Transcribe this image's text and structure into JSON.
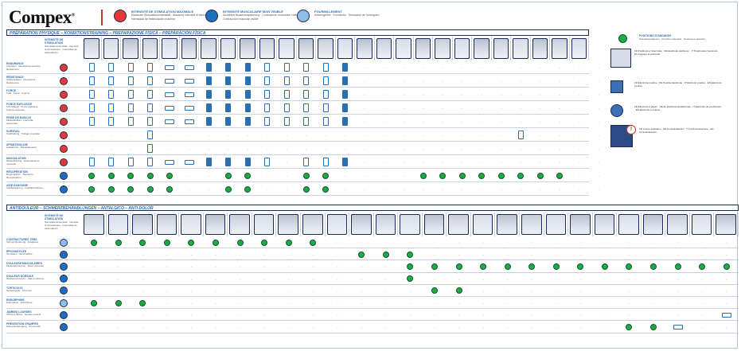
{
  "brand": {
    "name": "Compex",
    "mark": "®"
  },
  "legend": [
    {
      "color": "#e53935",
      "title": "INTENSITÉ DE STIMULATION MAXIMALE",
      "sub": "Maximale Stimulationsintensität · Massima intensità di stimolazione · Intensidad de estimulación máxima"
    },
    {
      "color": "#1e6fc0",
      "title": "INTENSITÉ MUSCULAIRE MON VISIBLE",
      "sub": "Sichtbare Muskelanspannung · Contrazione muscolare visibile · Contracción muscular visible"
    },
    {
      "color": "#8fbde6",
      "title": "FOURMILLEMENT",
      "sub": "Kribbelgefühl · Formicolio · Sensación de hormigueo"
    }
  ],
  "section1": {
    "title": "PRÉPARATION PHYSIQUE – KONDITIONSTRAINING – PREPARAZIONE FISICA – PREPARACIÓN FÍSICA",
    "colhead": {
      "title": "INTENSITÉ DE STIMULATION",
      "sub": "Stimulationsintensität · Intensità di stimolazione · Intensidad de estimulación"
    },
    "rows": [
      {
        "title": "ENDURANCE",
        "sub": "Ausdauer · Resistenza aerobica · Resistencia",
        "icon": "red",
        "cells": "P P P P F F A T A P P P P A . . . . . . . . . . . . ."
      },
      {
        "title": "RÉSISTANCE",
        "sub": "Kraftausdauer · Resistenza · Resistencia",
        "icon": "red",
        "cells": "P P P P F F A T A P P P P A . . . . . . . . . . . . ."
      },
      {
        "title": "FORCE",
        "sub": "Kraft · Forza · Fuerza",
        "icon": "red",
        "cells": "P P P P F F A T A P P P P A . . . . . . . . . . . . ."
      },
      {
        "title": "FORCE EXPLOSIVE",
        "sub": "Schnellkraft · Forza esplosiva · Fuerza explosiva",
        "icon": "red",
        "cells": "P P P P F F A T A P P P P A . . . . . . . . . . . . ."
      },
      {
        "title": "PRISE DE MUSCLE",
        "sub": "Muskelaufbau · Ipertrofia · Hipertrofia",
        "icon": "red",
        "cells": "P P P P F F A T A P P P P A . . . . . . . . . . . . ."
      },
      {
        "title": "SURVIVAL",
        "sub": "Krafttraining · Trabajo muscular",
        "icon": "red",
        "cells": ". . . P . . . . . . . . . . . . . . . . . . P . . . ."
      },
      {
        "title": "SPRINT/INCLINE",
        "sub": "Aufwärmen · Riscaldamento",
        "icon": "red",
        "cells": ". . . P . . . . . . . . . . . . . . . . . . . . . . ."
      },
      {
        "title": "MUSCULATION",
        "sub": "Muskeltraining · Entrenamiento muscular",
        "icon": "red",
        "cells": "P P P P F F A T A P . P P A . . . . . . . . . . . . ."
      },
      {
        "title": "RÉCUPÉRATION",
        "sub": "Regeneration · Recupero · Recuperación",
        "icon": "blue",
        "cells": "G G G G G . . G G . . G G . . . . G G G G G G G G . ."
      },
      {
        "title": "AIDE SANGUINE",
        "sub": "Kapillarisierung · Capillarizzazione",
        "icon": "blue",
        "cells": "G G G G G . . G G . . G G . . . . . . . . . . . . . ."
      }
    ]
  },
  "section2": {
    "title": "ANTIDOULEUR – SCHMERZBEHANDLUNGEN – ANTALGICO – ANTI-DOLOR",
    "colhead": {
      "title": "INTENSITÉ DE STIMULATION",
      "sub": "Stimulationsintensität · Intensità di stimolazione · Intensidad de estimulación"
    },
    "rows": [
      {
        "title": "CONTRACTURES TENS",
        "sub": "Schmerzlinderung · Analgesia",
        "icon": "light",
        "cells": "G G G G G G G G G G . . . . . . . . . . . . . . . . ."
      },
      {
        "title": "ÉPICONDYLITE",
        "sub": "Tennisarm · Epicondilitis",
        "icon": "blue",
        "cells": ". . . . . . . . . . . G G G . . . . . . . . . . . . ."
      },
      {
        "title": "DOULEURS MUSCULAIRES",
        "sub": "Muskelschmerzen · Dolor muscular",
        "icon": "blue",
        "cells": ". . . . . . . . . . . . . G G G G G G G G G G G G G G"
      },
      {
        "title": "DOULEUR DORSALE",
        "sub": "Rückenschmerzen · Mal di schiena",
        "icon": "blue",
        "cells": ". . . . . . . . . . . . . G . . . . . . . . . . . . ."
      },
      {
        "title": "TORTICOLIS",
        "sub": "Nackensteife · Torcicolo",
        "icon": "blue",
        "cells": ". . . . . . . . . . . . . . G G . . . . . . . . . . ."
      },
      {
        "title": "ENDORPHINE",
        "sub": "Endorphine · Endorfinas",
        "icon": "light",
        "cells": "G G G . . . . . . . . . . . . . . . . . . . . . . . ."
      },
      {
        "title": "JAMBES LOURDES",
        "sub": "Schwere Beine · Gambe pesanti",
        "icon": "blue",
        "cells": ". . . . . . . . . . . . . . . . . . . . . . . . . . K"
      },
      {
        "title": "PRÉVENTION CRAMPES",
        "sub": "Krampfvorbeugung · Prevención",
        "icon": "blue",
        "cells": ". . . . . . . . . . . . . . . . . . . . . . G G K . ."
      }
    ]
  },
  "side": {
    "title": "POSITIONS STANDARDS",
    "sub": "Standardpositionen · Posizioni standard · Posiciones estándar",
    "notes": [
      "FR Positionnez l'électrode · DE Elektrode platzieren · IT Posizionare l'elettrodo · ES Coloque el electrodo",
      "FR Électrode positive · DE Positive Elektrode · IT Elettrodo positivo · ES Electrodo positivo",
      "FR Électrode à placer · DE Zu platzierende Elektrode · IT Elettrodo da posizionare · ES Electrodo a colocar",
      "FR Contre-indication · DE Kontraindikation · IT Controindicazione · ES Contraindicación"
    ]
  },
  "empty_mark": "-"
}
